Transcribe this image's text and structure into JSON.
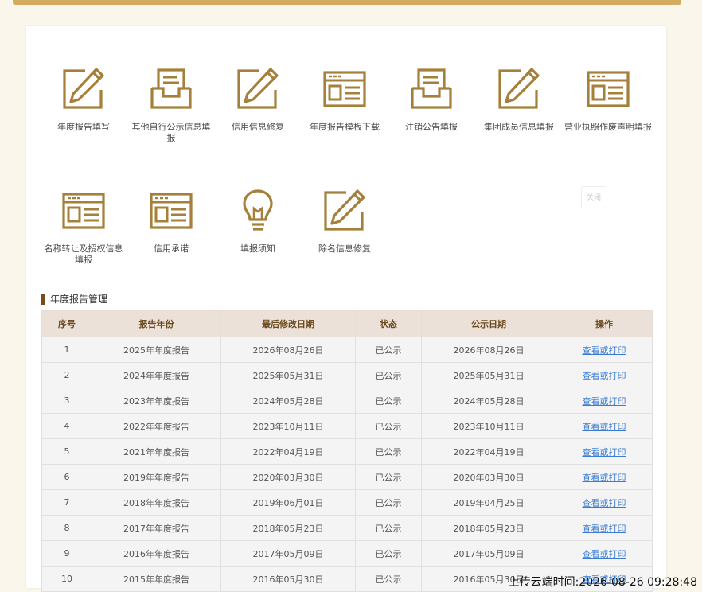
{
  "tiles": [
    {
      "label": "年度报告填写",
      "icon": "pencil-form-icon"
    },
    {
      "label": "其他自行公示信息填报",
      "icon": "inbox-tray-icon"
    },
    {
      "label": "信用信息修复",
      "icon": "pencil-form-icon"
    },
    {
      "label": "年度报告模板下载",
      "icon": "window-template-icon"
    },
    {
      "label": "注销公告填报",
      "icon": "inbox-tray-icon"
    },
    {
      "label": "集团成员信息填报",
      "icon": "pencil-form-icon"
    },
    {
      "label": "营业执照作废声明填报",
      "icon": "window-template-icon"
    },
    {
      "label": "名称转让及授权信息填报",
      "icon": "window-template-icon"
    },
    {
      "label": "信用承诺",
      "icon": "window-template-icon"
    },
    {
      "label": "填报须知",
      "icon": "lightbulb-icon"
    },
    {
      "label": "除名信息修复",
      "icon": "pencil-form-icon"
    }
  ],
  "close_label": "关闭",
  "section_title": "年度报告管理",
  "table": {
    "headers": [
      "序号",
      "报告年份",
      "最后修改日期",
      "状态",
      "公示日期",
      "操作"
    ],
    "rows": [
      [
        "1",
        "2025年年度报告",
        "2026年08月26日",
        "已公示",
        "2026年08月26日",
        "查看或打印"
      ],
      [
        "2",
        "2024年年度报告",
        "2025年05月31日",
        "已公示",
        "2025年05月31日",
        "查看或打印"
      ],
      [
        "3",
        "2023年年度报告",
        "2024年05月28日",
        "已公示",
        "2024年05月28日",
        "查看或打印"
      ],
      [
        "4",
        "2022年年度报告",
        "2023年10月11日",
        "已公示",
        "2023年10月11日",
        "查看或打印"
      ],
      [
        "5",
        "2021年年度报告",
        "2022年04月19日",
        "已公示",
        "2022年04月19日",
        "查看或打印"
      ],
      [
        "6",
        "2019年年度报告",
        "2020年03月30日",
        "已公示",
        "2020年03月30日",
        "查看或打印"
      ],
      [
        "7",
        "2018年年度报告",
        "2019年06月01日",
        "已公示",
        "2019年04月25日",
        "查看或打印"
      ],
      [
        "8",
        "2017年年度报告",
        "2018年05月23日",
        "已公示",
        "2018年05月23日",
        "查看或打印"
      ],
      [
        "9",
        "2016年年度报告",
        "2017年05月09日",
        "已公示",
        "2017年05月09日",
        "查看或打印"
      ],
      [
        "10",
        "2015年年度报告",
        "2016年05月30日",
        "已公示",
        "2016年05月30日",
        "查看或打印"
      ]
    ]
  },
  "upload_time": "上传云端时间:2026-08-26 09:28:48",
  "colors": {
    "accent": "#a4803a",
    "topbar": "#d3ab60",
    "header_bg": "#ebe1d8",
    "link": "#3c7bd4"
  }
}
